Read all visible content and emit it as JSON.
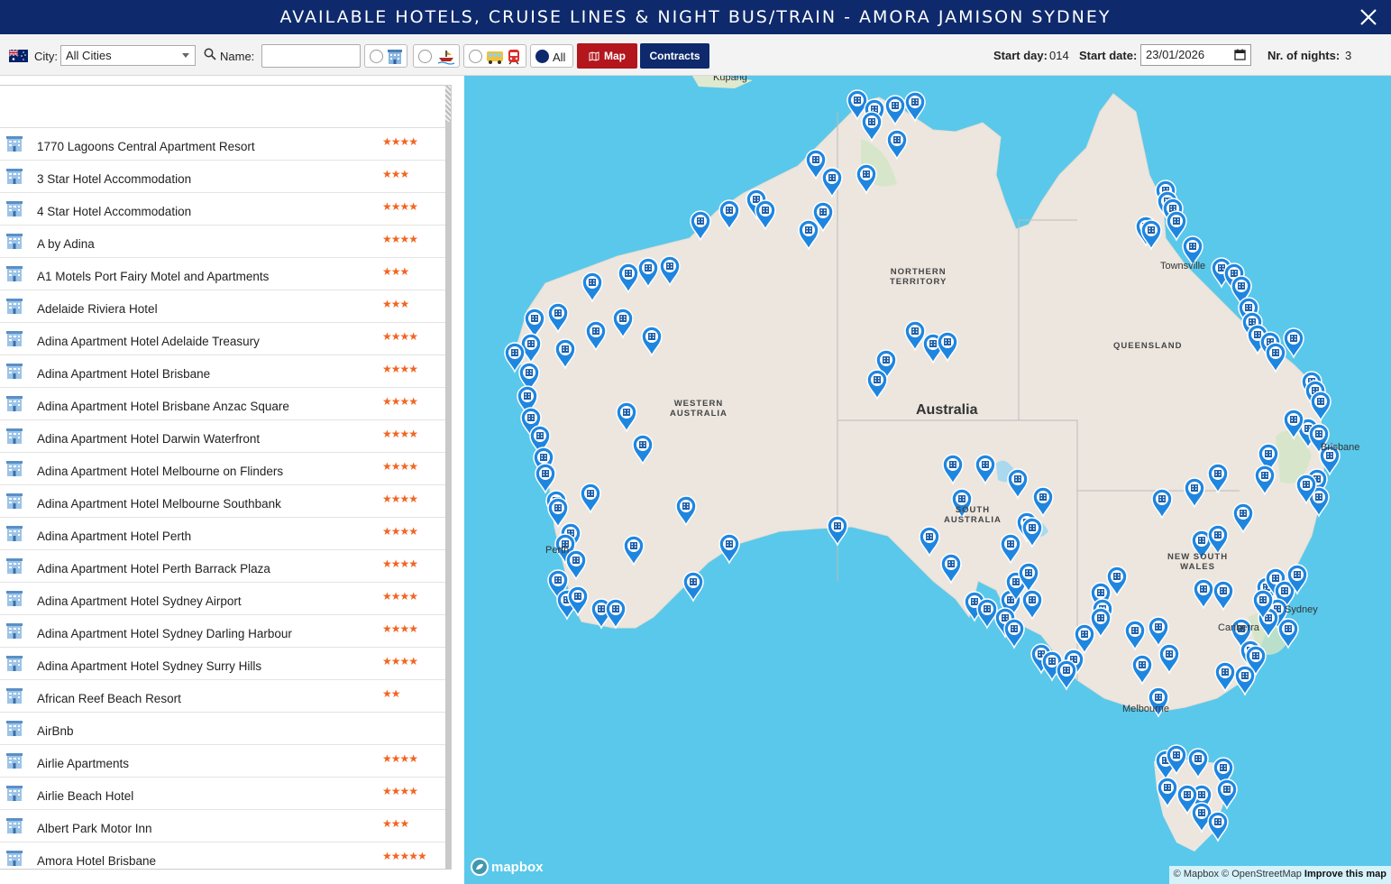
{
  "window": {
    "title": "AVAILABLE HOTELS, CRUISE LINES & NIGHT BUS/TRAIN - AMORA JAMISON SYDNEY"
  },
  "toolbar": {
    "city_label": "City:",
    "city_value": "All Cities",
    "name_label": "Name:",
    "name_value": "",
    "filter_all_label": "All",
    "map_button": "Map",
    "contracts_button": "Contracts",
    "start_day_label": "Start day:",
    "start_day_value": "014",
    "start_date_label": "Start date:",
    "start_date_value": "23/01/2026",
    "nights_label": "Nr. of nights:",
    "nights_value": "3"
  },
  "hotels": [
    {
      "name": "1770 Lagoons Central Apartment Resort",
      "stars": "★★★★"
    },
    {
      "name": "3 Star Hotel Accommodation",
      "stars": "★★★"
    },
    {
      "name": "4 Star Hotel Accommodation",
      "stars": "★★★★"
    },
    {
      "name": "A by Adina",
      "stars": "★★★★"
    },
    {
      "name": "A1 Motels Port Fairy Motel and Apartments",
      "stars": "★★★"
    },
    {
      "name": "Adelaide Riviera Hotel",
      "stars": "★★★"
    },
    {
      "name": "Adina Apartment Hotel Adelaide Treasury",
      "stars": "★★★★"
    },
    {
      "name": "Adina Apartment Hotel Brisbane",
      "stars": "★★★★"
    },
    {
      "name": "Adina Apartment Hotel Brisbane Anzac Square",
      "stars": "★★★★"
    },
    {
      "name": "Adina Apartment Hotel Darwin Waterfront",
      "stars": "★★★★"
    },
    {
      "name": "Adina Apartment Hotel Melbourne on Flinders",
      "stars": "★★★★"
    },
    {
      "name": "Adina Apartment Hotel Melbourne Southbank",
      "stars": "★★★★"
    },
    {
      "name": "Adina Apartment Hotel Perth",
      "stars": "★★★★"
    },
    {
      "name": "Adina Apartment Hotel Perth Barrack Plaza",
      "stars": "★★★★"
    },
    {
      "name": "Adina Apartment Hotel Sydney Airport",
      "stars": "★★★★"
    },
    {
      "name": "Adina Apartment Hotel Sydney Darling Harbour",
      "stars": "★★★★"
    },
    {
      "name": "Adina Apartment Hotel Sydney Surry Hills",
      "stars": "★★★★"
    },
    {
      "name": "African Reef Beach Resort",
      "stars": "★★"
    },
    {
      "name": "AirBnb",
      "stars": ""
    },
    {
      "name": "Airlie Apartments",
      "stars": "★★★★"
    },
    {
      "name": "Airlie Beach Hotel",
      "stars": "★★★★"
    },
    {
      "name": "Albert Park Motor Inn",
      "stars": "★★★"
    },
    {
      "name": "Amora Hotel Brisbane",
      "stars": "★★★★★"
    }
  ],
  "map": {
    "labels": {
      "country": "Australia",
      "nt": "NORTHERN\nTERRITORY",
      "wa": "WESTERN\nAUSTRALIA",
      "qld": "QUEENSLAND",
      "sa": "SOUTH\nAUSTRALIA",
      "nsw": "NEW SOUTH\nWALES",
      "kupang": "Kupang",
      "townsville": "Townsville",
      "brisbane": "Brisbane",
      "sydney": "Sydney",
      "canberra": "Canberra",
      "melbourne": "Melbourne",
      "perth": "Perth"
    },
    "attribution_mapbox": "© Mapbox",
    "attribution_osm": "© OpenStreetMap",
    "attribution_improve": "Improve this map",
    "logo_text": "mapbox",
    "colors": {
      "ocean": "#5ac8ea",
      "land": "#ece6df",
      "pin": "#1f86e0"
    }
  }
}
